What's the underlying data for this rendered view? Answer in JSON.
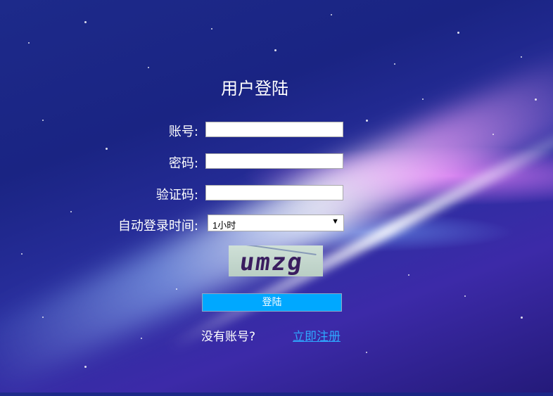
{
  "form": {
    "title": "用户登陆",
    "account_label": "账号:",
    "account_value": "",
    "password_label": "密码:",
    "password_value": "",
    "captcha_label": "验证码:",
    "captcha_value": "",
    "auto_login_label": "自动登录时间:",
    "auto_login_selected": "1小时",
    "captcha_text": "umzg",
    "submit_label": "登陆",
    "no_account_text": "没有账号?",
    "register_link": "立即注册"
  },
  "icons": {
    "select_arrow": "chevron-down-icon"
  },
  "colors": {
    "button": "#00a8ff",
    "link": "#2ea8ff"
  }
}
